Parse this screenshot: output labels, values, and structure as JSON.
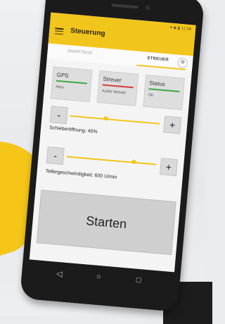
{
  "app": {
    "title": "Steuerung"
  },
  "statusbar": {
    "text": "▾ ◆ ▮ 11:58"
  },
  "tabs": [
    {
      "label": "SMARTBOX"
    },
    {
      "label": "STREUER"
    }
  ],
  "cards": [
    {
      "label": "GPS",
      "status": "Aktiv",
      "color": "#3aa845"
    },
    {
      "label": "Streuer",
      "status": "Außer Betrieb",
      "color": "#d83a3a"
    },
    {
      "label": "Status",
      "status": "OK",
      "color": "#3aa845"
    }
  ],
  "controls": {
    "minus": "-",
    "plus": "+",
    "slider1_label": "Schieberöffnung: 40%",
    "slider1_value": 0.4,
    "slider2_label": "Tellergeschwindigkeit: 600 U/min",
    "slider2_value": 0.75
  },
  "start_button": {
    "label": "Starten"
  },
  "navbar": {
    "back": "◁",
    "home": "○",
    "recent": "□"
  },
  "theme": {
    "accent": "#f2c51c"
  }
}
